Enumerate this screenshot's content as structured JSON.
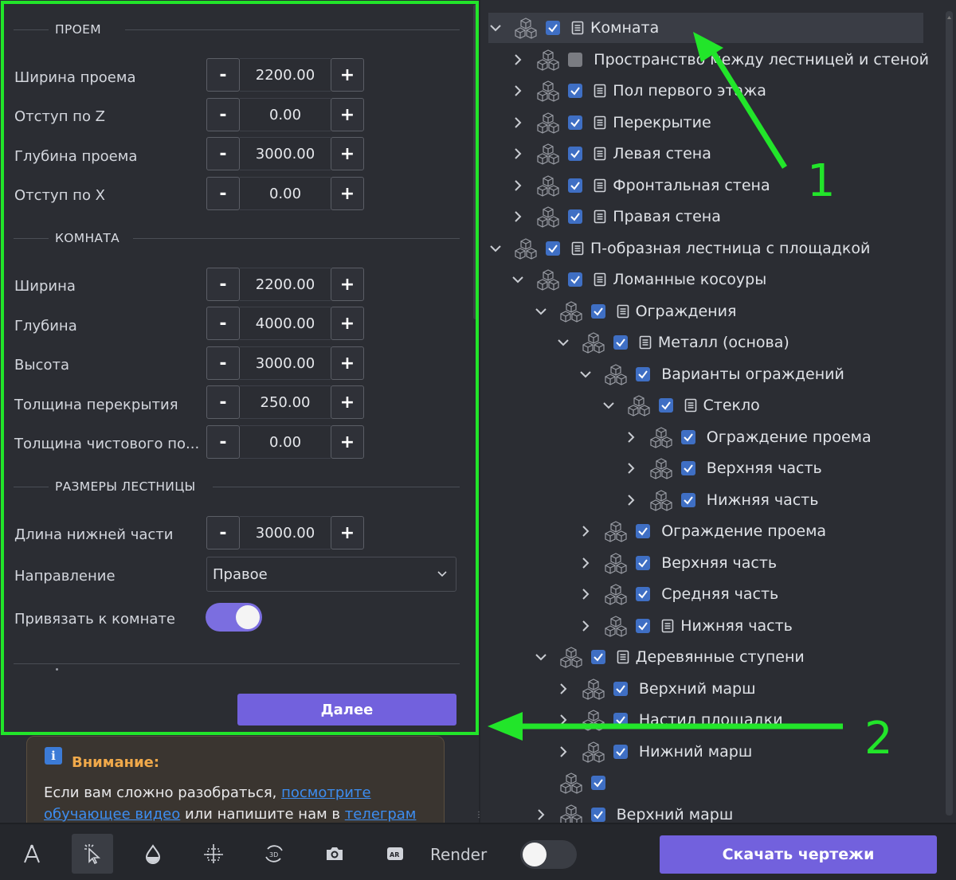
{
  "form": {
    "sections": {
      "opening": "ПРОЕМ",
      "room": "КОМНАТА",
      "stairs": "РАЗМЕРЫ ЛЕСТНИЦЫ"
    },
    "fields": [
      {
        "label": "Ширина проема",
        "value": "2200.00"
      },
      {
        "label": "Отступ по Z",
        "value": "0.00"
      },
      {
        "label": "Глубина проема",
        "value": "3000.00"
      },
      {
        "label": "Отступ по X",
        "value": "0.00"
      },
      {
        "label": "Ширина",
        "value": "2200.00"
      },
      {
        "label": "Глубина",
        "value": "4000.00"
      },
      {
        "label": "Высота",
        "value": "3000.00"
      },
      {
        "label": "Толщина перекрытия",
        "value": "250.00"
      },
      {
        "label": "Толщина чистового по...",
        "value": "0.00"
      },
      {
        "label": "Длина нижней части",
        "value": "3000.00"
      }
    ],
    "minus": "-",
    "plus": "+",
    "direction": {
      "label": "Направление",
      "value": "Правое"
    },
    "bind_room": {
      "label": "Привязать к комнате",
      "on": true
    },
    "next_button": "Далее"
  },
  "notice": {
    "icon": "i",
    "title": "Внимание:",
    "text_1": "Если вам сложно разобраться, ",
    "link_1": "посмотрите обучающее видео",
    "text_2": " или напишите нам в ",
    "link_2": "телеграм"
  },
  "tree": [
    {
      "label": "Комната",
      "expanded": true,
      "checked": true,
      "doc": true,
      "selected": true
    },
    {
      "label": "Пространство между лестницей и стеной",
      "expanded": false,
      "checked": false,
      "doc": false
    },
    {
      "label": "Пол первого этажа",
      "expanded": false,
      "checked": true,
      "doc": true
    },
    {
      "label": "Перекрытие",
      "expanded": false,
      "checked": true,
      "doc": true
    },
    {
      "label": "Левая стена",
      "expanded": false,
      "checked": true,
      "doc": true
    },
    {
      "label": "Фронтальная стена",
      "expanded": false,
      "checked": true,
      "doc": true
    },
    {
      "label": "Правая стена",
      "expanded": false,
      "checked": true,
      "doc": true
    },
    {
      "label": "П-образная лестница с площадкой",
      "expanded": true,
      "checked": true,
      "doc": true
    },
    {
      "label": "Ломанные косоуры",
      "expanded": true,
      "checked": true,
      "doc": true
    },
    {
      "label": "Ограждения",
      "expanded": true,
      "checked": true,
      "doc": true
    },
    {
      "label": "Металл (основа)",
      "expanded": true,
      "checked": true,
      "doc": true
    },
    {
      "label": "Варианты ограждений",
      "expanded": true,
      "checked": true,
      "doc": false
    },
    {
      "label": "Стекло",
      "expanded": true,
      "checked": true,
      "doc": true
    },
    {
      "label": "Ограждение проема",
      "expanded": false,
      "checked": true,
      "doc": false
    },
    {
      "label": "Верхняя часть",
      "expanded": false,
      "checked": true,
      "doc": false
    },
    {
      "label": "Нижняя часть",
      "expanded": false,
      "checked": true,
      "doc": false
    },
    {
      "label": "Ограждение проема",
      "expanded": false,
      "checked": true,
      "doc": false
    },
    {
      "label": "Верхняя часть",
      "expanded": false,
      "checked": true,
      "doc": false
    },
    {
      "label": "Средняя часть",
      "expanded": false,
      "checked": true,
      "doc": false
    },
    {
      "label": "Нижняя часть",
      "expanded": false,
      "checked": true,
      "doc": true
    },
    {
      "label": "Деревянные ступени",
      "expanded": true,
      "checked": true,
      "doc": true
    },
    {
      "label": "Верхний марш",
      "expanded": false,
      "checked": true,
      "doc": false
    },
    {
      "label": "Настил площадки",
      "expanded": false,
      "checked": true,
      "doc": false
    },
    {
      "label": "Нижний марш",
      "expanded": false,
      "checked": true,
      "doc": false
    },
    {
      "label": "",
      "expanded": null,
      "checked": true,
      "doc": false
    },
    {
      "label": "Верхний марш",
      "expanded": false,
      "checked": true,
      "doc": false
    }
  ],
  "annotations": {
    "one": "1",
    "two": "2"
  },
  "toolbar": {
    "icons": [
      "measure-icon",
      "select-cursor-icon",
      "material-drop-icon",
      "dimension-icon",
      "rotate-3d-icon",
      "camera-icon",
      "ar-icon"
    ],
    "three_d": "3D",
    "ar": "AR",
    "render_label": "Render",
    "render_on": false,
    "download_button": "Скачать чертежи"
  },
  "colors": {
    "accent": "#7261dd",
    "highlight": "#22e52a",
    "checkbox": "#3f6fc4",
    "notice_title": "#f0a94a",
    "link": "#3d8df0"
  }
}
